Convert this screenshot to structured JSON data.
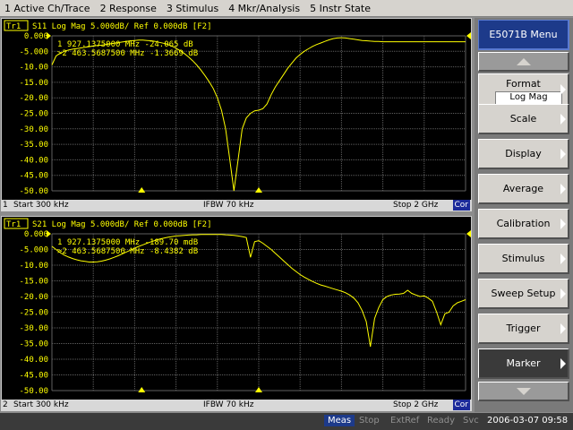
{
  "menu": [
    "1 Active Ch/Trace",
    "2 Response",
    "3 Stimulus",
    "4 Mkr/Analysis",
    "5 Instr State"
  ],
  "colors": {
    "trace": "#ffff00",
    "grid": "#606060",
    "graticule_text": "#ffff00",
    "accent": "#1d3a8a"
  },
  "ch1": {
    "active_badge": "Tr1",
    "header": "S11 Log Mag 5.000dB/ Ref 0.000dB [F2]",
    "y_ticks": [
      "0.000",
      "-5.000",
      "-10.00",
      "-15.00",
      "-20.00",
      "-25.00",
      "-30.00",
      "-35.00",
      "-40.00",
      "-45.00",
      "-50.00"
    ],
    "markers": [
      {
        "id": "1",
        "text": " 1  927.1375000 MHz -24.065 dB"
      },
      {
        "id": ">2",
        "text": ">2  463.5687500 MHz -1.3669 dB"
      }
    ],
    "status": {
      "channel": "1",
      "start": "Start 300 kHz",
      "ifbw": "IFBW 70 kHz",
      "stop": "Stop 2 GHz",
      "cor": "Cor"
    },
    "trace_dB": [
      -9.4,
      -6.5,
      -5.6,
      -5.0,
      -4.6,
      -4.3,
      -4.1,
      -3.9,
      -3.7,
      -3.5,
      -3.3,
      -3.1,
      -3.0,
      -2.8,
      -2.6,
      -2.4,
      -2.2,
      -2.0,
      -1.8,
      -1.6,
      -1.5,
      -1.4,
      -1.4,
      -1.5,
      -1.6,
      -1.8,
      -2.1,
      -2.4,
      -2.8,
      -3.3,
      -4.0,
      -4.8,
      -5.7,
      -6.8,
      -8.0,
      -9.4,
      -11.0,
      -12.8,
      -14.8,
      -17.0,
      -20.0,
      -24.0,
      -30.0,
      -40.0,
      -50.0,
      -40.0,
      -30.0,
      -26.5,
      -25.0,
      -24.2,
      -24.0,
      -23.5,
      -22.0,
      -19.0,
      -16.5,
      -14.5,
      -12.5,
      -10.5,
      -8.8,
      -7.2,
      -6.0,
      -5.0,
      -4.2,
      -3.4,
      -2.8,
      -2.3,
      -1.8,
      -1.3,
      -0.9,
      -0.7,
      -0.6,
      -0.7,
      -0.9,
      -1.1,
      -1.3,
      -1.5,
      -1.6,
      -1.7,
      -1.8,
      -1.8,
      -1.9,
      -1.9,
      -1.9,
      -1.9,
      -1.9,
      -1.9,
      -1.9,
      -1.9,
      -1.9,
      -1.9,
      -1.9,
      -1.9,
      -1.9,
      -1.9,
      -1.9,
      -1.9,
      -1.9,
      -1.9,
      -1.9,
      -1.9,
      -1.9
    ]
  },
  "ch2": {
    "active_badge": "Tr1",
    "header": "S21 Log Mag 5.000dB/ Ref 0.000dB [F2]",
    "y_ticks": [
      "0.000",
      "-5.000",
      "-10.00",
      "-15.00",
      "-20.00",
      "-25.00",
      "-30.00",
      "-35.00",
      "-40.00",
      "-45.00",
      "-50.00"
    ],
    "markers": [
      {
        "id": "1",
        "text": " 1  927.1375000 MHz -189.70 mdB"
      },
      {
        "id": ">2",
        "text": ">2  463.5687500 MHz -8.4382 dB"
      }
    ],
    "status": {
      "channel": "2",
      "start": "Start 300 kHz",
      "ifbw": "IFBW 70 kHz",
      "stop": "Stop 2 GHz",
      "cor": "Cor"
    },
    "trace_dB": [
      -4.0,
      -5.0,
      -6.0,
      -6.8,
      -7.4,
      -7.9,
      -8.3,
      -8.6,
      -8.8,
      -9.0,
      -9.0,
      -8.9,
      -8.7,
      -8.4,
      -8.0,
      -7.5,
      -7.0,
      -6.4,
      -5.8,
      -5.2,
      -4.6,
      -4.0,
      -3.5,
      -3.0,
      -2.5,
      -2.1,
      -1.7,
      -1.4,
      -1.1,
      -0.9,
      -0.7,
      -0.6,
      -0.5,
      -0.4,
      -0.3,
      -0.3,
      -0.2,
      -0.2,
      -0.2,
      -0.2,
      -0.2,
      -0.2,
      -0.3,
      -0.4,
      -0.5,
      -0.7,
      -0.9,
      -1.2,
      -7.5,
      -2.5,
      -2.2,
      -3.0,
      -4.0,
      -5.0,
      -6.2,
      -7.4,
      -8.6,
      -9.8,
      -11.0,
      -12.0,
      -13.0,
      -13.8,
      -14.5,
      -15.2,
      -15.8,
      -16.3,
      -16.7,
      -17.1,
      -17.5,
      -17.9,
      -18.3,
      -18.8,
      -19.5,
      -20.5,
      -22.0,
      -24.5,
      -28.0,
      -36.0,
      -27.0,
      -23.5,
      -21.0,
      -20.0,
      -19.5,
      -19.3,
      -19.2,
      -19.0,
      -18.0,
      -19.0,
      -19.5,
      -20.0,
      -19.8,
      -20.5,
      -21.5,
      -25.0,
      -29.0,
      -25.5,
      -25.0,
      -23.0,
      -22.0,
      -21.5,
      -21.0
    ]
  },
  "softkeys": {
    "title": "E5071B Menu",
    "format_label": "Format",
    "format_value": "Log Mag",
    "items": [
      "Scale",
      "Display",
      "Average",
      "Calibration",
      "Stimulus",
      "Sweep Setup",
      "Trigger",
      "Marker"
    ]
  },
  "statusbar": {
    "meas": "Meas",
    "stop": "Stop",
    "extref": "ExtRef",
    "ready": "Ready",
    "svc": "Svc",
    "datetime": "2006-03-07 09:58"
  }
}
